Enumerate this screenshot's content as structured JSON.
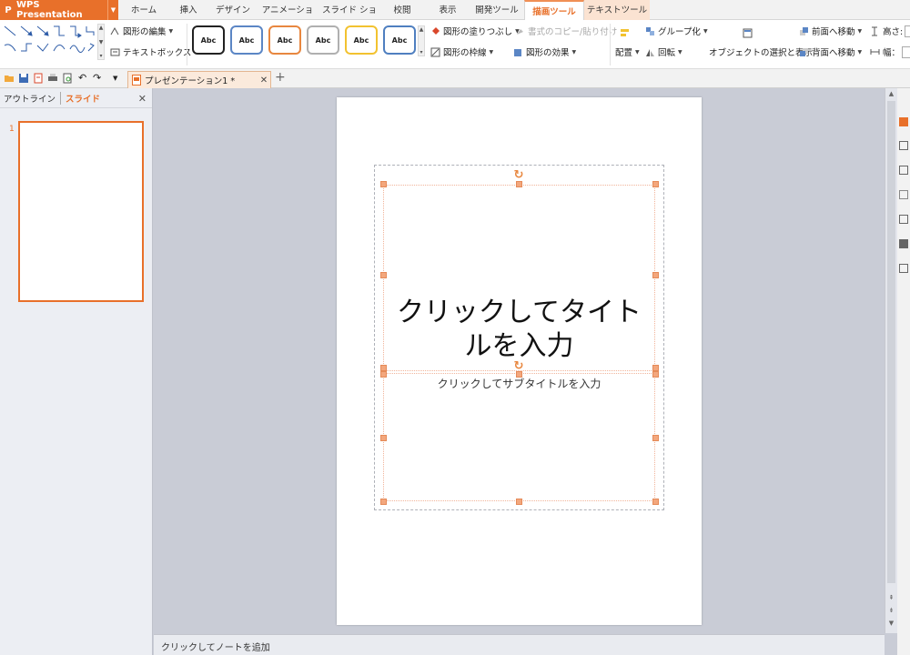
{
  "app": {
    "name": "WPS Presentation",
    "accent": "#e8702a"
  },
  "menu": {
    "tabs": [
      "ホーム",
      "挿入",
      "デザイン",
      "アニメーション",
      "スライド ショー",
      "校閲",
      "表示",
      "開発ツール",
      "描画ツール",
      "テキストツール"
    ],
    "active_tab": "描画ツール"
  },
  "ribbon": {
    "edit_shape": "図形の編集",
    "text_box": "テキストボックス",
    "style_label": "Abc",
    "shape_fill": "図形の塗りつぶし",
    "shape_outline": "図形の枠線",
    "copy_format": "書式のコピー/貼り付け",
    "shape_effects": "図形の効果",
    "align": "配置",
    "group": "グループ化",
    "rotate": "回転",
    "selection_pane": "オブジェクトの選択と表示",
    "bring_forward": "前面へ移動",
    "send_backward": "背面へ移動",
    "height_label": "高さ:",
    "width_label": "幅："
  },
  "document": {
    "tab_name": "プレゼンテーション1 *"
  },
  "panel": {
    "outline_tab": "アウトライン",
    "slides_tab": "スライド",
    "slide_number": "1"
  },
  "slide": {
    "title_placeholder": "クリックしてタイトルを入力",
    "subtitle_placeholder": "クリックしてサブタイトルを入力"
  },
  "notes": {
    "placeholder": "クリックしてノートを追加"
  }
}
